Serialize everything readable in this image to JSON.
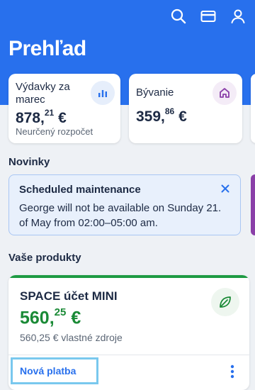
{
  "header": {
    "title": "Prehľad",
    "icons": [
      "search-icon",
      "card-icon",
      "user-icon"
    ]
  },
  "tiles": [
    {
      "label": "Výdavky za marec",
      "amount_main": "878,",
      "amount_cents": "21",
      "currency": "€",
      "subtext": "Neurčený rozpočet",
      "icon": "bar-chart-icon"
    },
    {
      "label": "Bývanie",
      "amount_main": "359,",
      "amount_cents": "86",
      "currency": "€",
      "icon": "house-icon"
    }
  ],
  "news": {
    "section_title": "Novinky",
    "title": "Scheduled maintenance",
    "body": "George will not be available on Sunday 21. of May from 02:00–05:00 am."
  },
  "products": {
    "section_title": "Vaše produkty",
    "account": {
      "name": "SPACE účet MINI",
      "amount_main": "560,",
      "amount_cents": "25",
      "currency": "€",
      "own_funds": "560,25 € vlastné zdroje",
      "primary_action": "Nová platba",
      "icon": "leaf-icon"
    }
  },
  "colors": {
    "brand_blue": "#2870ed",
    "positive_green": "#1a8a36",
    "notice_bg": "#e8f0fc",
    "highlight": "#79c8ee"
  }
}
